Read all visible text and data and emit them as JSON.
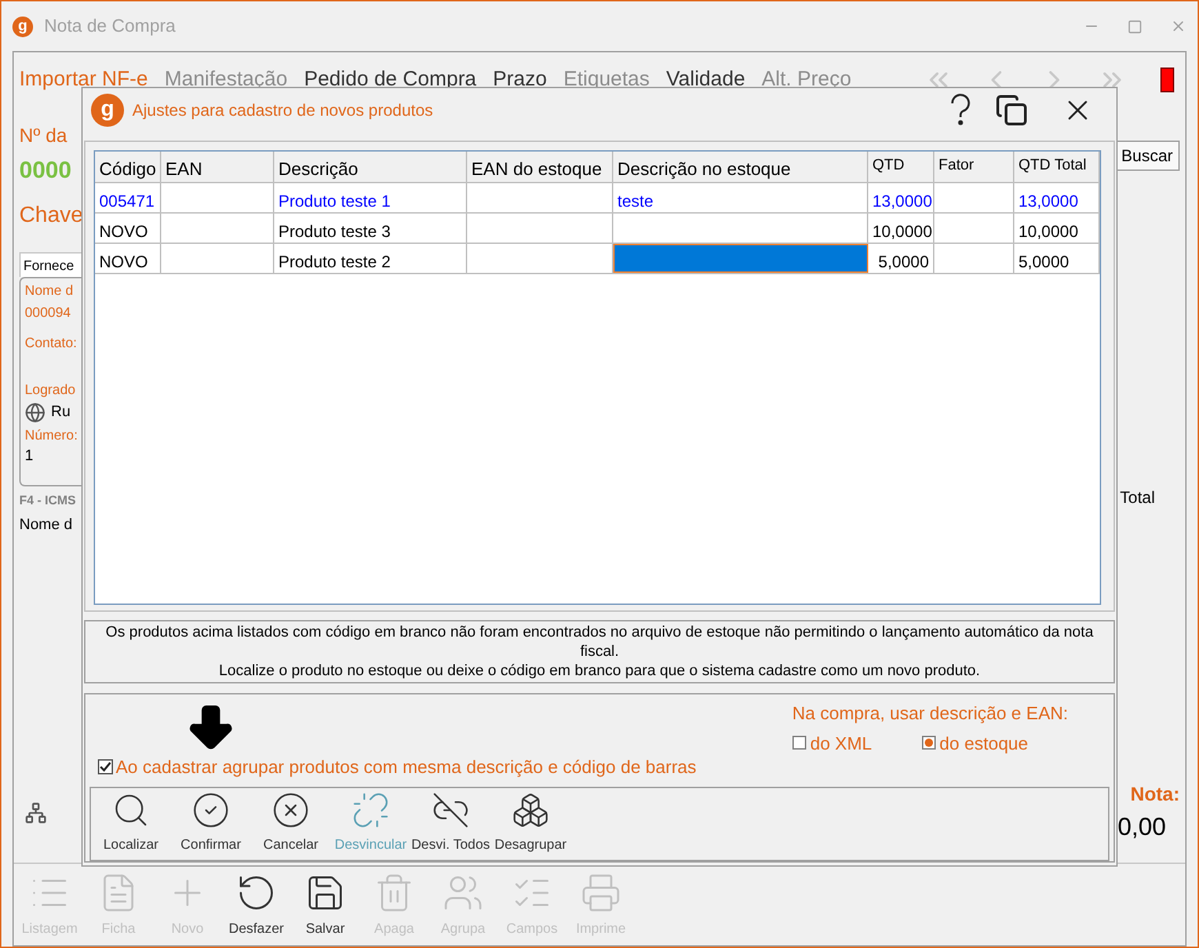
{
  "window": {
    "logo": "g",
    "title": "Nota de Compra"
  },
  "menu": [
    {
      "label": "Importar NF-e",
      "kind": "accent"
    },
    {
      "label": "Manifestação",
      "kind": "disabled"
    },
    {
      "label": "Pedido de Compra",
      "kind": "normal"
    },
    {
      "label": "Prazo",
      "kind": "normal"
    },
    {
      "label": "Etiquetas",
      "kind": "disabled"
    },
    {
      "label": "Validade",
      "kind": "normal"
    },
    {
      "label": "Alt. Preço",
      "kind": "disabled"
    }
  ],
  "left_panel": {
    "nf_label": "Nº da",
    "nf_number": "0000",
    "chave_label": "Chave",
    "tab": "Fornece",
    "nome_label": "Nome d",
    "nome_value": "000094",
    "contato_label": "Contato:",
    "logradouro_label": "Logrado",
    "logradouro_value": "Ru",
    "numero_label": "Número:",
    "numero_value": "1",
    "section": "F4 - ICMS",
    "column": "Nome d"
  },
  "right_panel": {
    "search_button": "Buscar",
    "total_column": "Total",
    "nota_label": "Nota:",
    "nota_value": "0,00"
  },
  "toolbar": [
    {
      "label": "Listagem",
      "disabled": true
    },
    {
      "label": "Ficha",
      "disabled": true
    },
    {
      "label": "Novo",
      "disabled": true
    },
    {
      "label": "Desfazer",
      "disabled": false
    },
    {
      "label": "Salvar",
      "disabled": false
    },
    {
      "label": "Apaga",
      "disabled": true
    },
    {
      "label": "Agrupa",
      "disabled": true
    },
    {
      "label": "Campos",
      "disabled": true
    },
    {
      "label": "Imprime",
      "disabled": true
    }
  ],
  "dialog": {
    "logo": "g",
    "title": "Ajustes para cadastro de novos produtos",
    "table": {
      "columns": [
        "Código",
        "EAN",
        "Descrição",
        "EAN do estoque",
        "Descrição no estoque",
        "QTD",
        "Fator",
        "QTD Total"
      ],
      "rows": [
        {
          "codigo": "005471",
          "descricao": "Produto teste 1",
          "descricao_estoque": "teste",
          "qtd": "13,0000",
          "qtd_total": "13,0000",
          "linked": true,
          "selected": false
        },
        {
          "codigo": "NOVO",
          "descricao": "Produto teste 3",
          "qtd": "10,0000",
          "qtd_total": "10,0000",
          "linked": false,
          "selected": false
        },
        {
          "codigo": "NOVO",
          "descricao": "Produto teste 2",
          "qtd": "5,0000",
          "qtd_total": "5,0000",
          "linked": false,
          "selected": true
        }
      ]
    },
    "message": "Os produtos acima listados com código em branco não foram encontrados no arquivo de estoque não permitindo o lançamento automático da nota fiscal.\nLocalize o produto no estoque ou deixe o código em branco para que o sistema cadastre como um novo produto.",
    "group_option": {
      "label": "Ao cadastrar agrupar produtos com mesma descrição e código de barras",
      "checked": true
    },
    "source_option": {
      "label": "Na compra, usar descrição e EAN:",
      "options": [
        {
          "label": "do XML",
          "selected": false
        },
        {
          "label": "do estoque",
          "selected": true
        }
      ]
    },
    "actions": [
      {
        "label": "Localizar",
        "highlighted": false
      },
      {
        "label": "Confirmar",
        "highlighted": false
      },
      {
        "label": "Cancelar",
        "highlighted": false
      },
      {
        "label": "Desvincular",
        "highlighted": true
      },
      {
        "label": "Desvi. Todos",
        "highlighted": false
      },
      {
        "label": "Desagrupar",
        "highlighted": false
      }
    ]
  }
}
